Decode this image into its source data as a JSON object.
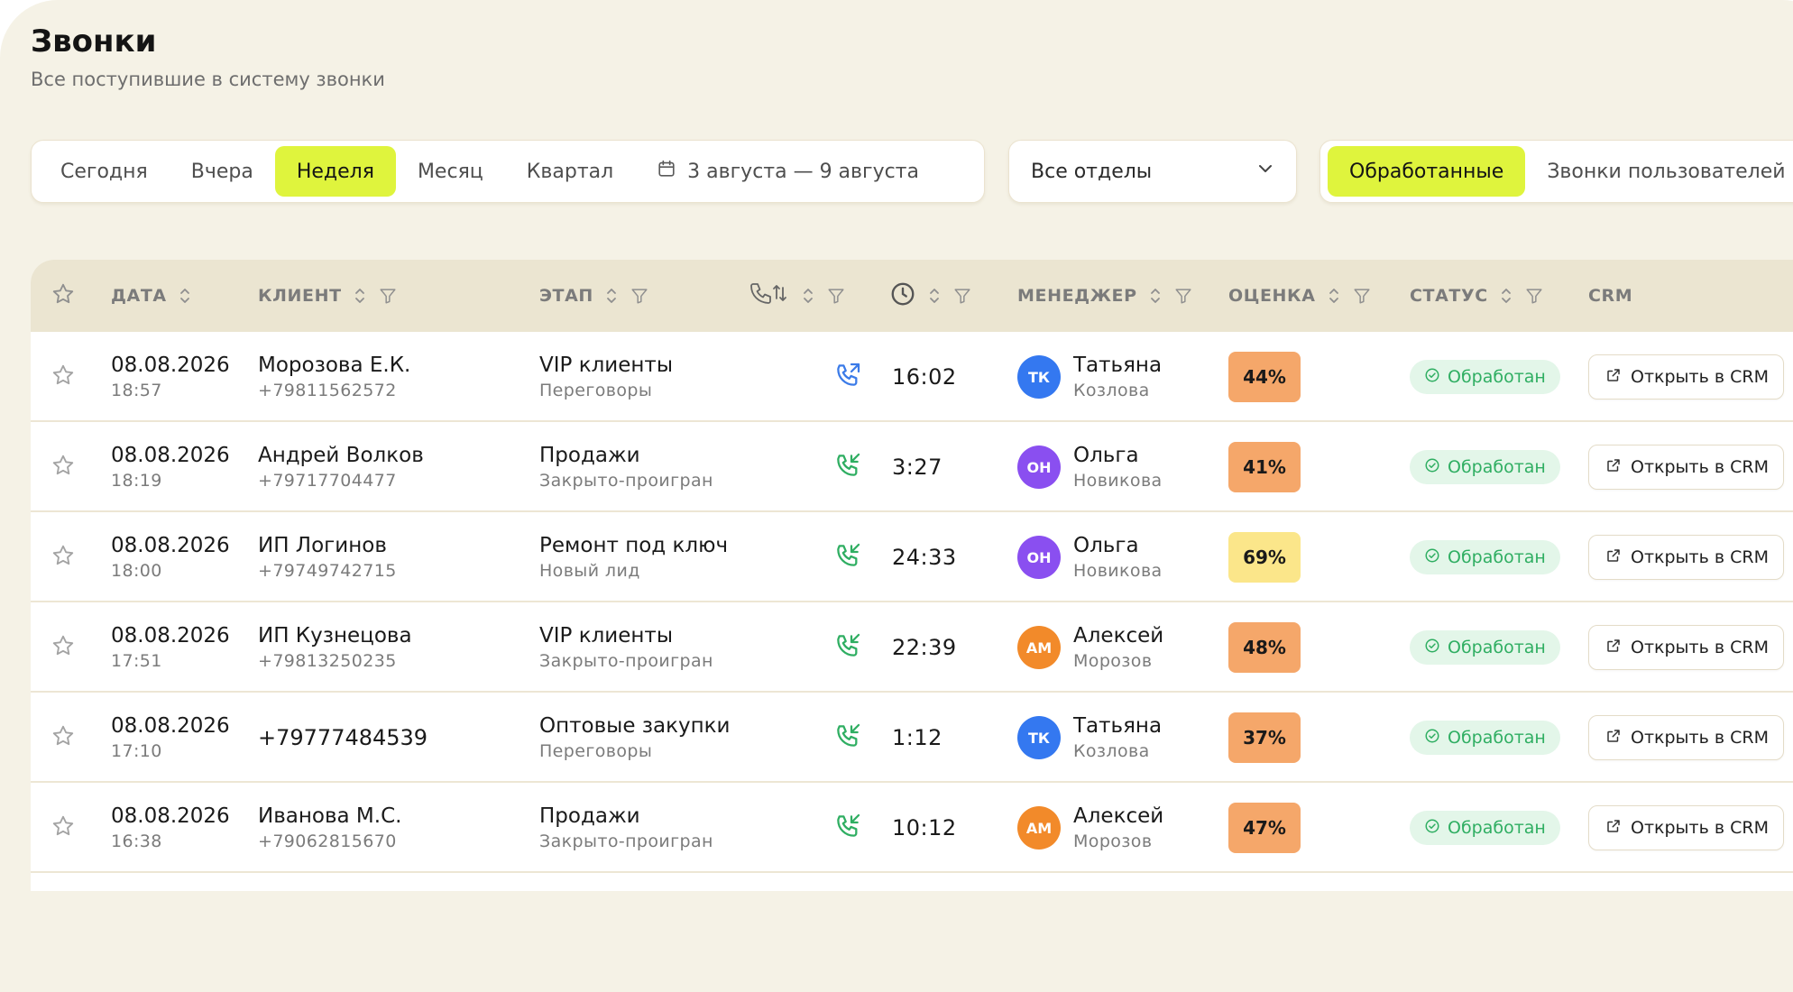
{
  "page": {
    "title": "Звонки",
    "subtitle": "Все поступившие в систему звонки"
  },
  "filters": {
    "periods": [
      {
        "label": "Сегодня",
        "active": false
      },
      {
        "label": "Вчера",
        "active": false
      },
      {
        "label": "Неделя",
        "active": true
      },
      {
        "label": "Месяц",
        "active": false
      },
      {
        "label": "Квартал",
        "active": false
      }
    ],
    "date_range": "3 августа — 9 августа",
    "department": "Все отделы",
    "status_tabs": [
      {
        "label": "Обработанные",
        "active": true
      },
      {
        "label": "Звонки пользователей",
        "active": false
      }
    ]
  },
  "table": {
    "headers": {
      "date": "ДАТА",
      "client": "КЛИЕНТ",
      "stage": "ЭТАП",
      "manager": "МЕНЕДЖЕР",
      "score": "ОЦЕНКА",
      "status": "СТАТУС",
      "crm": "CRM"
    },
    "rows": [
      {
        "date": "08.08.2026",
        "time": "18:57",
        "client": "Морозова Е.К.",
        "phone": "+79811562572",
        "stage": "VIP клиенты",
        "substage": "Переговоры",
        "direction": "outgoing",
        "duration": "16:02",
        "initials": "ТК",
        "avatar_color": "#3478f0",
        "manager_first": "Татьяна",
        "manager_last": "Козлова",
        "score": "44%",
        "score_color": "#f5a76a",
        "status": "Обработан",
        "crm": "Открыть в CRM"
      },
      {
        "date": "08.08.2026",
        "time": "18:19",
        "client": "Андрей Волков",
        "phone": "+79717704477",
        "stage": "Продажи",
        "substage": "Закрыто-проигран",
        "direction": "incoming",
        "duration": "3:27",
        "initials": "ОН",
        "avatar_color": "#8a4ff0",
        "manager_first": "Ольга",
        "manager_last": "Новикова",
        "score": "41%",
        "score_color": "#f5a76a",
        "status": "Обработан",
        "crm": "Открыть в CRM"
      },
      {
        "date": "08.08.2026",
        "time": "18:00",
        "client": "ИП Логинов",
        "phone": "+79749742715",
        "stage": "Ремонт под ключ",
        "substage": "Новый лид",
        "direction": "incoming",
        "duration": "24:33",
        "initials": "ОН",
        "avatar_color": "#8a4ff0",
        "manager_first": "Ольга",
        "manager_last": "Новикова",
        "score": "69%",
        "score_color": "#fbe68a",
        "status": "Обработан",
        "crm": "Открыть в CRM"
      },
      {
        "date": "08.08.2026",
        "time": "17:51",
        "client": "ИП Кузнецова",
        "phone": "+79813250235",
        "stage": "VIP клиенты",
        "substage": "Закрыто-проигран",
        "direction": "incoming",
        "duration": "22:39",
        "initials": "АМ",
        "avatar_color": "#f28a2a",
        "manager_first": "Алексей",
        "manager_last": "Морозов",
        "score": "48%",
        "score_color": "#f5a76a",
        "status": "Обработан",
        "crm": "Открыть в CRM"
      },
      {
        "date": "08.08.2026",
        "time": "17:10",
        "client": "+79777484539",
        "phone": "",
        "stage": "Оптовые закупки",
        "substage": "Переговоры",
        "direction": "incoming",
        "duration": "1:12",
        "initials": "ТК",
        "avatar_color": "#3478f0",
        "manager_first": "Татьяна",
        "manager_last": "Козлова",
        "score": "37%",
        "score_color": "#f5a76a",
        "status": "Обработан",
        "crm": "Открыть в CRM"
      },
      {
        "date": "08.08.2026",
        "time": "16:38",
        "client": "Иванова М.С.",
        "phone": "+79062815670",
        "stage": "Продажи",
        "substage": "Закрыто-проигран",
        "direction": "incoming",
        "duration": "10:12",
        "initials": "АМ",
        "avatar_color": "#f28a2a",
        "manager_first": "Алексей",
        "manager_last": "Морозов",
        "score": "47%",
        "score_color": "#f5a76a",
        "status": "Обработан",
        "crm": "Открыть в CRM"
      }
    ]
  }
}
